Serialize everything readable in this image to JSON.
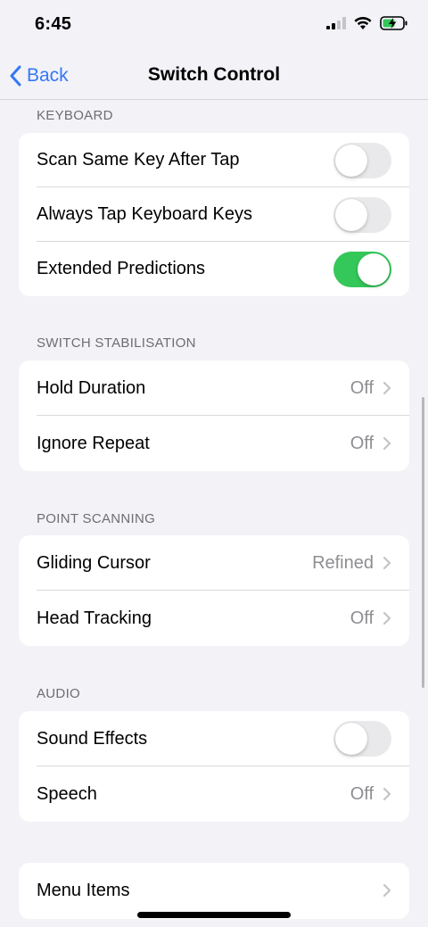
{
  "status": {
    "time": "6:45"
  },
  "nav": {
    "back_label": "Back",
    "title": "Switch Control"
  },
  "sections": {
    "keyboard": {
      "header": "KEYBOARD",
      "rows": [
        {
          "label": "Scan Same Key After Tap",
          "toggle_on": false
        },
        {
          "label": "Always Tap Keyboard Keys",
          "toggle_on": false
        },
        {
          "label": "Extended Predictions",
          "toggle_on": true
        }
      ]
    },
    "switch_stabilisation": {
      "header": "SWITCH STABILISATION",
      "rows": [
        {
          "label": "Hold Duration",
          "value": "Off"
        },
        {
          "label": "Ignore Repeat",
          "value": "Off"
        }
      ]
    },
    "point_scanning": {
      "header": "POINT SCANNING",
      "rows": [
        {
          "label": "Gliding Cursor",
          "value": "Refined"
        },
        {
          "label": "Head Tracking",
          "value": "Off"
        }
      ]
    },
    "audio": {
      "header": "AUDIO",
      "rows": [
        {
          "label": "Sound Effects",
          "toggle_on": false
        },
        {
          "label": "Speech",
          "value": "Off"
        }
      ]
    },
    "more": {
      "rows": [
        {
          "label": "Menu Items"
        }
      ]
    }
  },
  "colors": {
    "accent": "#3478f6",
    "toggle_on": "#34c759",
    "background": "#f2f2f7"
  }
}
